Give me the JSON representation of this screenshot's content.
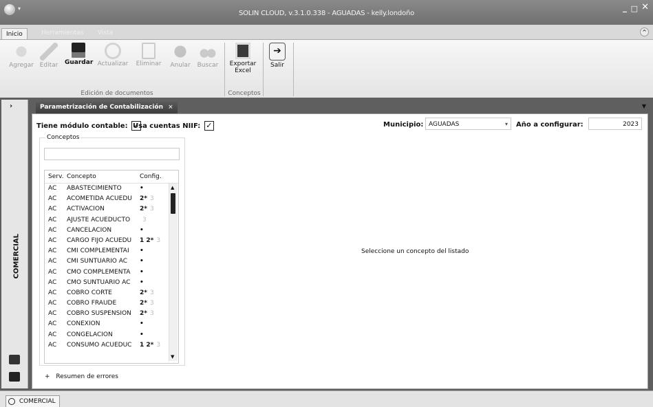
{
  "window": {
    "title": "SOLIN CLOUD, v.3.1.0.338 - AGUADAS - kelly.londoño"
  },
  "menu": {
    "tabs": [
      "Inicio",
      "Herramientas",
      "Vista"
    ]
  },
  "ribbon": {
    "buttons": {
      "agregar": "Agregar",
      "editar": "Editar",
      "guardar": "Guardar",
      "actualizar": "Actualizar",
      "eliminar": "Eliminar",
      "anular": "Anular",
      "buscar": "Buscar",
      "exportar": "Exportar Excel",
      "salir": "Salir"
    },
    "groups": {
      "edicion": "Edición de documentos",
      "conceptos": "Conceptos"
    }
  },
  "side": {
    "label": "COMERCIAL"
  },
  "document_tab": {
    "label": "Parametrización de Contabilización"
  },
  "options": {
    "modulo_label": "Tiene módulo contable:",
    "modulo_checked": "✓",
    "niif_label": "Usa cuentas NIIF:",
    "niif_checked": "✓",
    "municipio_label": "Municipio:",
    "municipio_value": "AGUADAS",
    "anio_label": "Año a configurar:",
    "anio_value": "2023"
  },
  "concepts": {
    "legend": "Conceptos",
    "search_value": "",
    "headers": [
      "Serv.",
      "Concepto",
      "Config."
    ],
    "rows": [
      {
        "serv": "AC",
        "concepto": "ABASTECIMIENTO",
        "config": "•",
        "dim": ""
      },
      {
        "serv": "AC",
        "concepto": "ACOMETIDA ACUEDU",
        "config": "2*",
        "dim": "3"
      },
      {
        "serv": "AC",
        "concepto": "ACTIVACIÓN",
        "config": "2*",
        "dim": "3"
      },
      {
        "serv": "AC",
        "concepto": "AJUSTE ACUEDUCTO",
        "config": "",
        "dim": "3"
      },
      {
        "serv": "AC",
        "concepto": "CANCELACIÓN",
        "config": "•",
        "dim": ""
      },
      {
        "serv": "AC",
        "concepto": "CARGO FIJO ACUEDU",
        "config": "1 2*",
        "dim": "3"
      },
      {
        "serv": "AC",
        "concepto": "CMI COMPLEMENTAI",
        "config": "•",
        "dim": ""
      },
      {
        "serv": "AC",
        "concepto": "CMI SUNTUARIO AC",
        "config": "•",
        "dim": ""
      },
      {
        "serv": "AC",
        "concepto": "CMO COMPLEMENTA",
        "config": "•",
        "dim": ""
      },
      {
        "serv": "AC",
        "concepto": "CMO SUNTUARIO AC",
        "config": "•",
        "dim": ""
      },
      {
        "serv": "AC",
        "concepto": "COBRO CORTE",
        "config": "2*",
        "dim": "3"
      },
      {
        "serv": "AC",
        "concepto": "COBRO FRAUDE",
        "config": "2*",
        "dim": "3"
      },
      {
        "serv": "AC",
        "concepto": "COBRO SUSPENSIÓN",
        "config": "2*",
        "dim": "3"
      },
      {
        "serv": "AC",
        "concepto": "CONEXIÓN",
        "config": "•",
        "dim": ""
      },
      {
        "serv": "AC",
        "concepto": "CONGELACIÓN",
        "config": "•",
        "dim": ""
      },
      {
        "serv": "AC",
        "concepto": "CONSUMO ACUEDUC",
        "config": "1 2*",
        "dim": "3"
      }
    ]
  },
  "detail": {
    "empty_message": "Seleccione un concepto del listado"
  },
  "errors": {
    "toggle": "+",
    "label": "Resumen de errores"
  },
  "bottom": {
    "tab_label": "COMERCIAL"
  }
}
